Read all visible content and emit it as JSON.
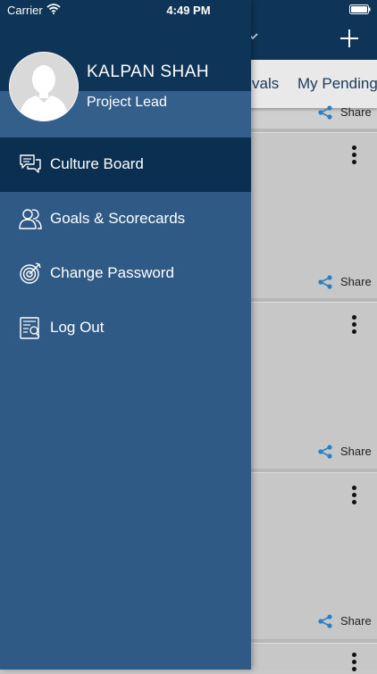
{
  "status_bar": {
    "carrier": "Carrier",
    "time": "4:49 PM"
  },
  "background": {
    "tabs": [
      "vals",
      "My Pending"
    ],
    "share_label": "Share"
  },
  "drawer": {
    "user": {
      "name": "KALPAN SHAH",
      "role": "Project Lead"
    },
    "menu": [
      {
        "label": "Culture Board",
        "icon": "chat-bubbles-icon",
        "active": true
      },
      {
        "label": "Goals & Scorecards",
        "icon": "users-icon",
        "active": false
      },
      {
        "label": "Change Password",
        "icon": "target-icon",
        "active": false
      },
      {
        "label": "Log Out",
        "icon": "logout-icon",
        "active": false
      }
    ]
  },
  "colors": {
    "drawer_bg": "#2f5a85",
    "header_bg": "#0e3557",
    "active_item_bg": "#0b2f51",
    "share_icon": "#2a7fc4"
  }
}
